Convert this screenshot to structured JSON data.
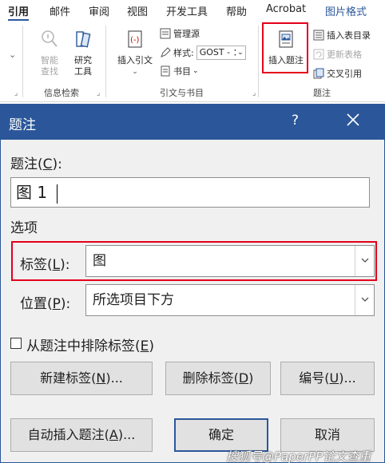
{
  "ribbon": {
    "tabs": [
      "引用",
      "邮件",
      "审阅",
      "视图",
      "开发工具",
      "帮助",
      "Acrobat",
      "图片格式"
    ],
    "groups": {
      "info_search": {
        "label": "信息检索",
        "smart_lookup": "智能\n查找",
        "researcher": "研究\n工具"
      },
      "citations": {
        "label": "引文与书目",
        "insert_citation": "插入引文",
        "manage_sources": "管理源",
        "style_label": "样式:",
        "style_value": "GOST - ：",
        "bibliography": "书目"
      },
      "captions": {
        "label": "题注",
        "insert_caption": "插入题注",
        "insert_table_of_figures": "插入表目录",
        "update_table": "更新表格",
        "cross_reference": "交叉引用"
      }
    }
  },
  "dialog": {
    "title": "题注",
    "help": "?",
    "caption_label": "题注(C):",
    "caption_label_prefix": "题注(",
    "caption_label_key": "C",
    "caption_label_suffix": "):",
    "caption_value": "图 1",
    "options_header": "选项",
    "label_field": {
      "prefix": "标签(",
      "key": "L",
      "suffix": "):",
      "value": "图"
    },
    "position_field": {
      "prefix": "位置(",
      "key": "P",
      "suffix": "):",
      "value": "所选项目下方"
    },
    "exclude_label": {
      "prefix": "从题注中排除标签(",
      "key": "E",
      "suffix": ")",
      "checked": false
    },
    "buttons": {
      "new_label": {
        "prefix": "新建标签(",
        "key": "N",
        "suffix": ")..."
      },
      "delete_label": {
        "prefix": "删除标签(",
        "key": "D",
        "suffix": ")"
      },
      "numbering": {
        "prefix": "编号(",
        "key": "U",
        "suffix": ")..."
      },
      "autocaption": {
        "prefix": "自动插入题注(",
        "key": "A",
        "suffix": ")..."
      },
      "ok": "确定",
      "cancel": "取消"
    }
  },
  "watermark": "搜狐号@PaperPP论文查重",
  "colors": {
    "accent": "#2b579a",
    "highlight": "#e3001b",
    "dialog_bg": "#f0f0f0"
  }
}
